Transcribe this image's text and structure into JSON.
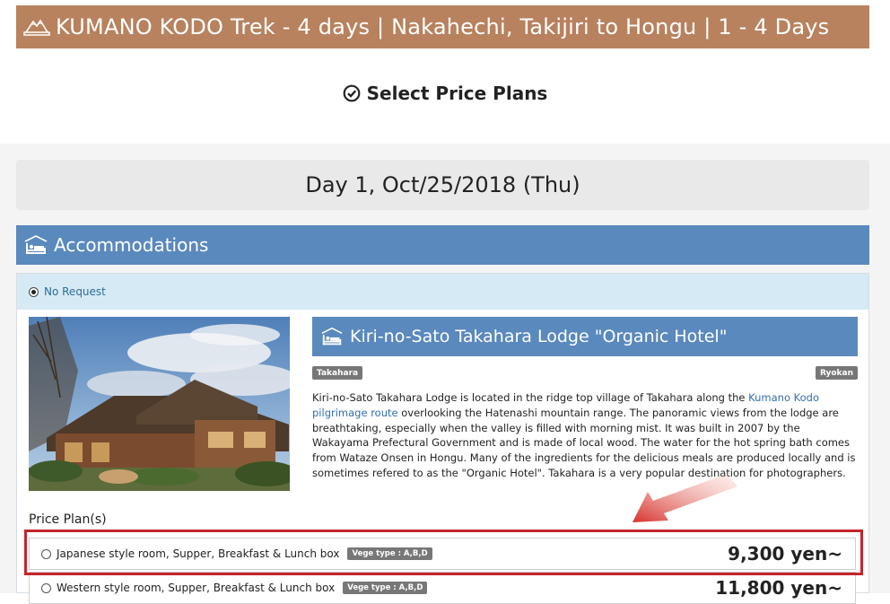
{
  "header": {
    "title": "KUMANO KODO Trek - 4 days | Nakahechi, Takijiri to Hongu | 1 - 4 Days",
    "icon": "mountain-icon"
  },
  "section": {
    "title": "Select Price Plans",
    "icon": "check-circle-icon"
  },
  "day": {
    "label": "Day 1, Oct/25/2018 (Thu)"
  },
  "accommodations": {
    "label": "Accommodations",
    "icon": "bed-icon",
    "no_request_label": "No Request",
    "lodge": {
      "name": "Kiri-no-Sato Takahara Lodge \"Organic Hotel\"",
      "icon": "bed-icon",
      "area_tag": "Takahara",
      "type_tag": "Ryokan",
      "desc_part1": "Kiri-no-Sato Takahara Lodge is located in the ridge top village of Takahara along the ",
      "desc_link": "Kumano Kodo pilgrimage route",
      "desc_part2": " overlooking the Hatenashi mountain range.  The panoramic views from the lodge are breathtaking, especially when the valley is filled with morning mist.  It was built in 2007 by the Wakayama Prefectural Government and is made of local wood.  The water for the hot spring bath comes from Wataze Onsen in Hongu.  Many of the ingredients for the delicious meals are produced locally and is sometimes refered to as the \"Organic Hotel\".  Takahara is a very popular destination for photographers."
    },
    "price_plans_label": "Price Plan(s)",
    "plans": [
      {
        "name": "Japanese style room, Supper, Breakfast & Lunch box",
        "vege": "Vege type : A,B,D",
        "price": "9,300 yen~"
      },
      {
        "name": "Western style room, Supper, Breakfast & Lunch box",
        "vege": "Vege type : A,B,D",
        "price": "11,800 yen~"
      }
    ]
  },
  "colors": {
    "header_bg": "#b8825e",
    "section_bar": "#5a89bd",
    "highlight": "#c4252a"
  }
}
